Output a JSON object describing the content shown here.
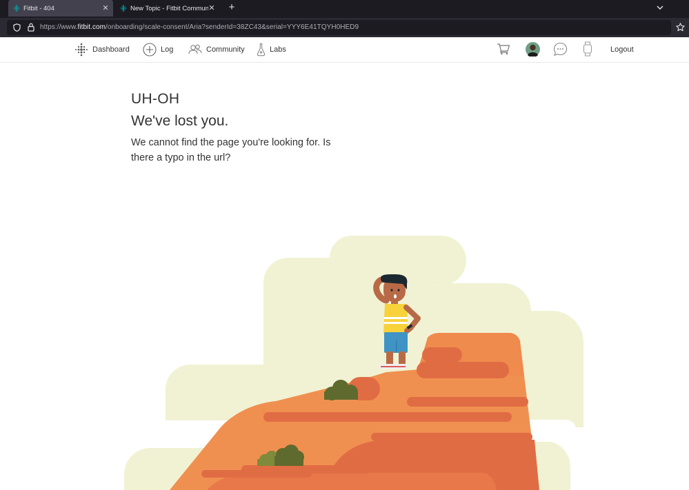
{
  "browser": {
    "tabs": [
      {
        "title": "Fitbit - 404",
        "active": true,
        "icon": "fitbit-icon"
      },
      {
        "title": "New Topic - Fitbit Community",
        "active": false,
        "icon": "fitbit-icon"
      }
    ],
    "url": {
      "prefix": "https://www.",
      "domain": "fitbit.com",
      "path": "/onboarding/scale-consent/Aria?senderId=38ZC43&serial=YYY6E41TQYH0HED9"
    }
  },
  "nav": {
    "items": [
      {
        "label": "Dashboard",
        "icon": "dashboard-dots-icon"
      },
      {
        "label": "Log",
        "icon": "plus-circle-icon"
      },
      {
        "label": "Community",
        "icon": "people-icon"
      },
      {
        "label": "Labs",
        "icon": "flask-icon"
      }
    ],
    "right": {
      "cart_icon": "cart-icon",
      "avatar_icon": "avatar",
      "messages_icon": "chat-bubble-icon",
      "device_icon": "watch-icon",
      "logout_label": "Logout"
    }
  },
  "error": {
    "code_title": "UH-OH",
    "subtitle": "We've lost you.",
    "message": "We cannot find the page you're looking for. Is there a typo in the url?"
  },
  "colors": {
    "accent": "#00b0b9",
    "text": "#333333",
    "cloud": "#f1f2d3",
    "rock_light": "#f09050",
    "rock_dark": "#e06c44",
    "bush": "#5f6a2e"
  }
}
